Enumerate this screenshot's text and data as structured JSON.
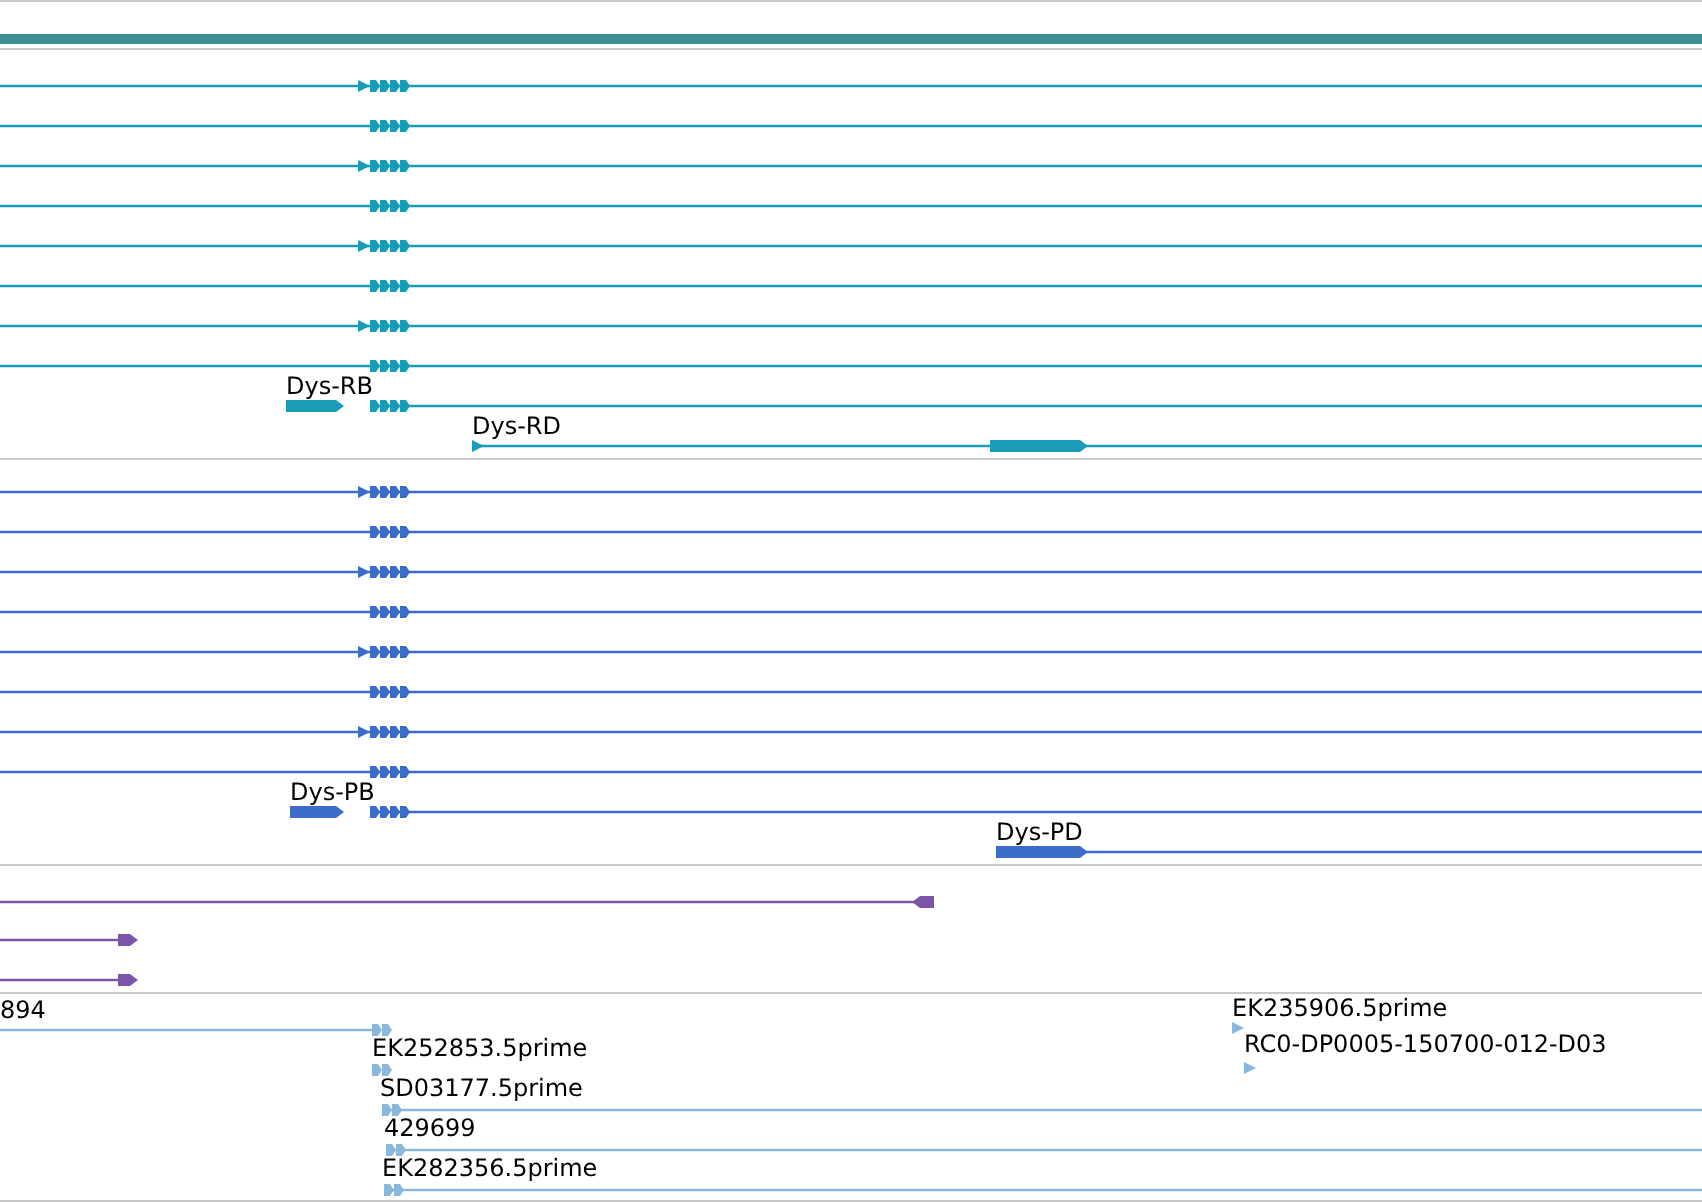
{
  "ruler": {
    "color": "#3a8f93"
  },
  "tracks": [
    {
      "kind": "transcripts",
      "color": "#1a9cb8",
      "labels": [
        {
          "text": "Dys-RB"
        },
        {
          "text": "Dys-RD"
        }
      ]
    },
    {
      "kind": "proteins",
      "color": "#3a6cc8",
      "labels": [
        {
          "text": "Dys-PB"
        },
        {
          "text": "Dys-PD"
        }
      ]
    },
    {
      "kind": "alignments",
      "color": "#7b55a8"
    },
    {
      "kind": "ests",
      "color": "#8ab8dc",
      "labels": [
        {
          "text": "894"
        },
        {
          "text": "EK252853.5prime"
        },
        {
          "text": "SD03177.5prime"
        },
        {
          "text": "429699"
        },
        {
          "text": "EK282356.5prime"
        },
        {
          "text": "EK235906.5prime"
        },
        {
          "text": "RC0-DP0005-150700-012-D03"
        }
      ]
    }
  ]
}
